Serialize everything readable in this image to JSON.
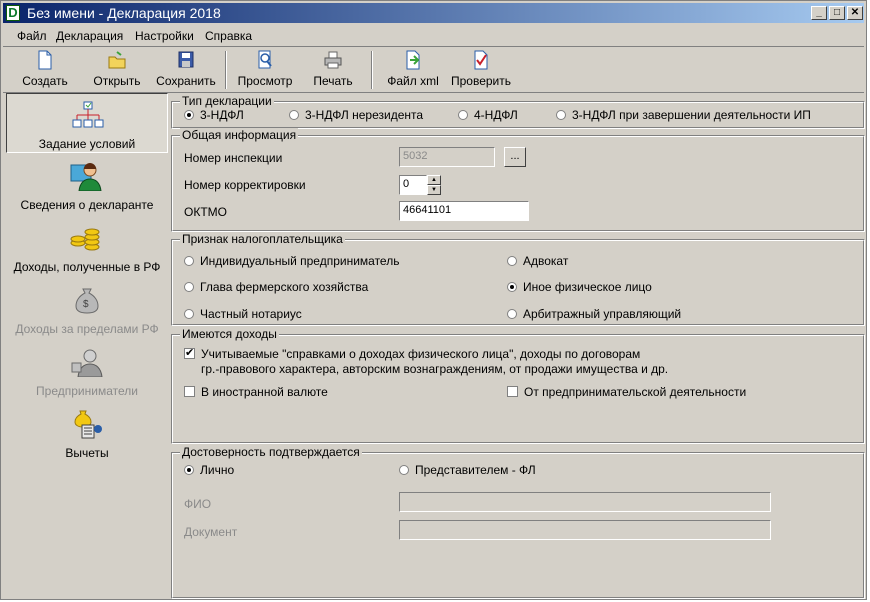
{
  "window": {
    "title": "Без имени - Декларация 2018",
    "app_icon_letter": "D"
  },
  "menu": [
    "Файл",
    "Декларация",
    "Настройки",
    "Справка"
  ],
  "toolbar": {
    "create": "Создать",
    "open": "Открыть",
    "save": "Сохранить",
    "preview": "Просмотр",
    "print": "Печать",
    "xml": "Файл xml",
    "check": "Проверить"
  },
  "nav": [
    {
      "label": "Задание условий",
      "selected": true,
      "enabled": true
    },
    {
      "label": "Сведения о декларанте",
      "enabled": true
    },
    {
      "label": "Доходы, полученные в РФ",
      "enabled": true
    },
    {
      "label": "Доходы за пределами РФ",
      "enabled": false
    },
    {
      "label": "Предприниматели",
      "enabled": false
    },
    {
      "label": "Вычеты",
      "enabled": true
    }
  ],
  "decl_type": {
    "title": "Тип декларации",
    "options": [
      "3-НДФЛ",
      "3-НДФЛ нерезидента",
      "4-НДФЛ",
      "3-НДФЛ при завершении деятельности ИП"
    ],
    "selected": "3-НДФЛ"
  },
  "general": {
    "title": "Общая информация",
    "inspection_label": "Номер инспекции",
    "inspection_value": "5032",
    "browse_label": "...",
    "correction_label": "Номер корректировки",
    "correction_value": "0",
    "oktmo_label": "ОКТМО",
    "oktmo_value": "46641101"
  },
  "taxpayer": {
    "title": "Признак налогоплательщика",
    "options": [
      "Индивидуальный предприниматель",
      "Адвокат",
      "Глава фермерского хозяйства",
      "Иное физическое лицо",
      "Частный нотариус",
      "Арбитражный управляющий"
    ],
    "selected": "Иное физическое лицо"
  },
  "incomes": {
    "title": "Имеются доходы",
    "reference_line1": "Учитываемые \"справками о доходах физического лица\", доходы по договорам",
    "reference_line2": "гр.-правового характера, авторским вознаграждениям, от продажи имущества и др.",
    "reference_checked": true,
    "foreign_currency": "В иностранной валюте",
    "foreign_checked": false,
    "business": "От предпринимательской деятельности",
    "business_checked": false
  },
  "confirm": {
    "title": "Достоверность подтверждается",
    "personal": "Лично",
    "representative": "Представителем - ФЛ",
    "selected": "Лично",
    "fio_label": "ФИО",
    "fio_value": "",
    "document_label": "Документ",
    "document_value": ""
  }
}
